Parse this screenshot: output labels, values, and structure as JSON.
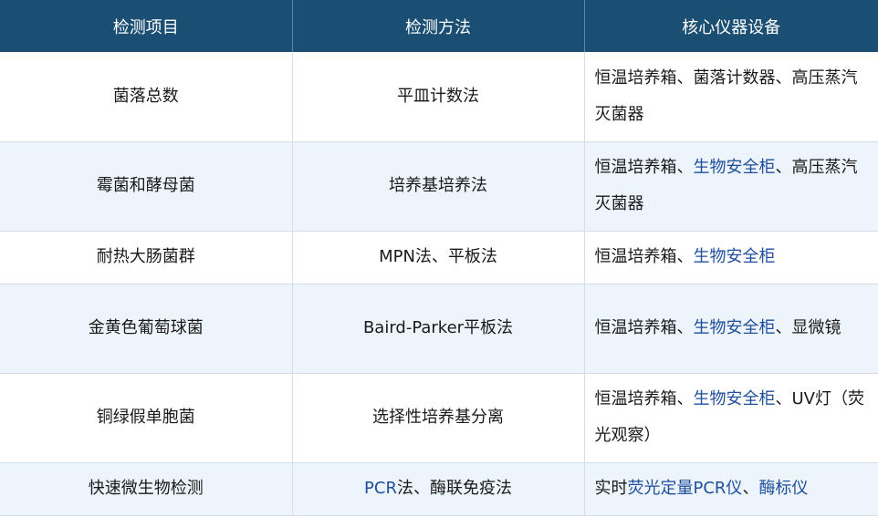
{
  "header": {
    "col1": "检测项目",
    "col2": "检测方法",
    "col3": "核心仪器设备"
  },
  "rows": [
    {
      "item": "菌落总数",
      "method": [
        {
          "t": "平皿计数法"
        }
      ],
      "equipment": [
        {
          "t": "恒温培养箱、菌落计数器、高压蒸汽灭菌器"
        }
      ]
    },
    {
      "item": "霉菌和酵母菌",
      "method": [
        {
          "t": "培养基培养法"
        }
      ],
      "equipment": [
        {
          "t": "恒温培养箱、"
        },
        {
          "t": "生物安全柜",
          "link": true
        },
        {
          "t": "、高压蒸汽灭菌器"
        }
      ]
    },
    {
      "item": "耐热大肠菌群",
      "method": [
        {
          "t": "MPN法、平板法"
        }
      ],
      "equipment": [
        {
          "t": "恒温培养箱、"
        },
        {
          "t": "生物安全柜",
          "link": true
        }
      ]
    },
    {
      "item": "金黄色葡萄球菌",
      "method": [
        {
          "t": "Baird-Parker平板法"
        }
      ],
      "equipment": [
        {
          "t": "恒温培养箱、"
        },
        {
          "t": "生物安全柜",
          "link": true
        },
        {
          "t": "、显微镜"
        }
      ]
    },
    {
      "item": "铜绿假单胞菌",
      "method": [
        {
          "t": "选择性培养基分离"
        }
      ],
      "equipment": [
        {
          "t": "恒温培养箱、"
        },
        {
          "t": "生物安全柜",
          "link": true
        },
        {
          "t": "、UV灯（荧光观察）"
        }
      ]
    },
    {
      "item": "快速微生物检测",
      "method": [
        {
          "t": "PCR",
          "link": true
        },
        {
          "t": "法、酶联免疫法"
        }
      ],
      "equipment": [
        {
          "t": "实时"
        },
        {
          "t": "荧光定量PCR仪",
          "link": true
        },
        {
          "t": "、"
        },
        {
          "t": "酶标仪",
          "link": true
        }
      ]
    }
  ],
  "colors": {
    "header_bg": "#1b4e73",
    "header_text": "#ffffff",
    "alt_row_bg": "#edf4fb",
    "link_text": "#1f4e9c"
  }
}
